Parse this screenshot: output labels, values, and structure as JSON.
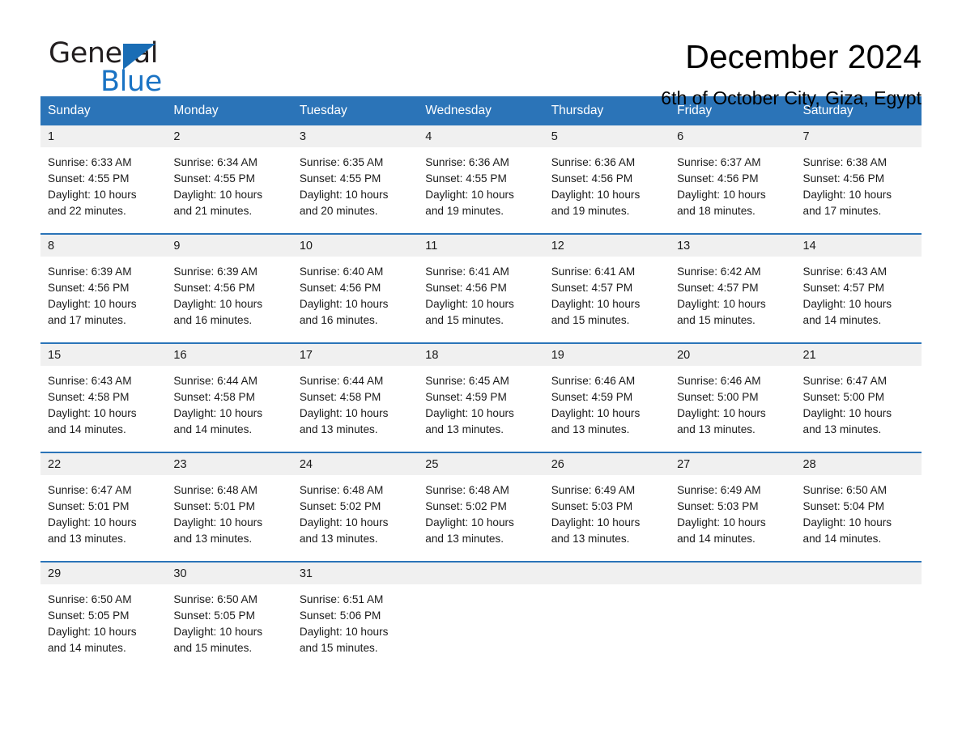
{
  "brand": {
    "name_part1": "General",
    "name_part2": "Blue",
    "triangle_color": "#1a6db5",
    "blue_color": "#1a73c4"
  },
  "header": {
    "month_title": "December 2024",
    "location": "6th of October City, Giza, Egypt"
  },
  "theme": {
    "header_bg": "#2b74b8",
    "daynum_bg": "#f0f0f0",
    "divider": "#2b74b8",
    "text": "#1a1a1a"
  },
  "weekday_headers": [
    "Sunday",
    "Monday",
    "Tuesday",
    "Wednesday",
    "Thursday",
    "Friday",
    "Saturday"
  ],
  "weeks": [
    [
      {
        "day": "1",
        "sunrise": "Sunrise: 6:33 AM",
        "sunset": "Sunset: 4:55 PM",
        "daylight_line1": "Daylight: 10 hours",
        "daylight_line2": "and 22 minutes."
      },
      {
        "day": "2",
        "sunrise": "Sunrise: 6:34 AM",
        "sunset": "Sunset: 4:55 PM",
        "daylight_line1": "Daylight: 10 hours",
        "daylight_line2": "and 21 minutes."
      },
      {
        "day": "3",
        "sunrise": "Sunrise: 6:35 AM",
        "sunset": "Sunset: 4:55 PM",
        "daylight_line1": "Daylight: 10 hours",
        "daylight_line2": "and 20 minutes."
      },
      {
        "day": "4",
        "sunrise": "Sunrise: 6:36 AM",
        "sunset": "Sunset: 4:55 PM",
        "daylight_line1": "Daylight: 10 hours",
        "daylight_line2": "and 19 minutes."
      },
      {
        "day": "5",
        "sunrise": "Sunrise: 6:36 AM",
        "sunset": "Sunset: 4:56 PM",
        "daylight_line1": "Daylight: 10 hours",
        "daylight_line2": "and 19 minutes."
      },
      {
        "day": "6",
        "sunrise": "Sunrise: 6:37 AM",
        "sunset": "Sunset: 4:56 PM",
        "daylight_line1": "Daylight: 10 hours",
        "daylight_line2": "and 18 minutes."
      },
      {
        "day": "7",
        "sunrise": "Sunrise: 6:38 AM",
        "sunset": "Sunset: 4:56 PM",
        "daylight_line1": "Daylight: 10 hours",
        "daylight_line2": "and 17 minutes."
      }
    ],
    [
      {
        "day": "8",
        "sunrise": "Sunrise: 6:39 AM",
        "sunset": "Sunset: 4:56 PM",
        "daylight_line1": "Daylight: 10 hours",
        "daylight_line2": "and 17 minutes."
      },
      {
        "day": "9",
        "sunrise": "Sunrise: 6:39 AM",
        "sunset": "Sunset: 4:56 PM",
        "daylight_line1": "Daylight: 10 hours",
        "daylight_line2": "and 16 minutes."
      },
      {
        "day": "10",
        "sunrise": "Sunrise: 6:40 AM",
        "sunset": "Sunset: 4:56 PM",
        "daylight_line1": "Daylight: 10 hours",
        "daylight_line2": "and 16 minutes."
      },
      {
        "day": "11",
        "sunrise": "Sunrise: 6:41 AM",
        "sunset": "Sunset: 4:56 PM",
        "daylight_line1": "Daylight: 10 hours",
        "daylight_line2": "and 15 minutes."
      },
      {
        "day": "12",
        "sunrise": "Sunrise: 6:41 AM",
        "sunset": "Sunset: 4:57 PM",
        "daylight_line1": "Daylight: 10 hours",
        "daylight_line2": "and 15 minutes."
      },
      {
        "day": "13",
        "sunrise": "Sunrise: 6:42 AM",
        "sunset": "Sunset: 4:57 PM",
        "daylight_line1": "Daylight: 10 hours",
        "daylight_line2": "and 15 minutes."
      },
      {
        "day": "14",
        "sunrise": "Sunrise: 6:43 AM",
        "sunset": "Sunset: 4:57 PM",
        "daylight_line1": "Daylight: 10 hours",
        "daylight_line2": "and 14 minutes."
      }
    ],
    [
      {
        "day": "15",
        "sunrise": "Sunrise: 6:43 AM",
        "sunset": "Sunset: 4:58 PM",
        "daylight_line1": "Daylight: 10 hours",
        "daylight_line2": "and 14 minutes."
      },
      {
        "day": "16",
        "sunrise": "Sunrise: 6:44 AM",
        "sunset": "Sunset: 4:58 PM",
        "daylight_line1": "Daylight: 10 hours",
        "daylight_line2": "and 14 minutes."
      },
      {
        "day": "17",
        "sunrise": "Sunrise: 6:44 AM",
        "sunset": "Sunset: 4:58 PM",
        "daylight_line1": "Daylight: 10 hours",
        "daylight_line2": "and 13 minutes."
      },
      {
        "day": "18",
        "sunrise": "Sunrise: 6:45 AM",
        "sunset": "Sunset: 4:59 PM",
        "daylight_line1": "Daylight: 10 hours",
        "daylight_line2": "and 13 minutes."
      },
      {
        "day": "19",
        "sunrise": "Sunrise: 6:46 AM",
        "sunset": "Sunset: 4:59 PM",
        "daylight_line1": "Daylight: 10 hours",
        "daylight_line2": "and 13 minutes."
      },
      {
        "day": "20",
        "sunrise": "Sunrise: 6:46 AM",
        "sunset": "Sunset: 5:00 PM",
        "daylight_line1": "Daylight: 10 hours",
        "daylight_line2": "and 13 minutes."
      },
      {
        "day": "21",
        "sunrise": "Sunrise: 6:47 AM",
        "sunset": "Sunset: 5:00 PM",
        "daylight_line1": "Daylight: 10 hours",
        "daylight_line2": "and 13 minutes."
      }
    ],
    [
      {
        "day": "22",
        "sunrise": "Sunrise: 6:47 AM",
        "sunset": "Sunset: 5:01 PM",
        "daylight_line1": "Daylight: 10 hours",
        "daylight_line2": "and 13 minutes."
      },
      {
        "day": "23",
        "sunrise": "Sunrise: 6:48 AM",
        "sunset": "Sunset: 5:01 PM",
        "daylight_line1": "Daylight: 10 hours",
        "daylight_line2": "and 13 minutes."
      },
      {
        "day": "24",
        "sunrise": "Sunrise: 6:48 AM",
        "sunset": "Sunset: 5:02 PM",
        "daylight_line1": "Daylight: 10 hours",
        "daylight_line2": "and 13 minutes."
      },
      {
        "day": "25",
        "sunrise": "Sunrise: 6:48 AM",
        "sunset": "Sunset: 5:02 PM",
        "daylight_line1": "Daylight: 10 hours",
        "daylight_line2": "and 13 minutes."
      },
      {
        "day": "26",
        "sunrise": "Sunrise: 6:49 AM",
        "sunset": "Sunset: 5:03 PM",
        "daylight_line1": "Daylight: 10 hours",
        "daylight_line2": "and 13 minutes."
      },
      {
        "day": "27",
        "sunrise": "Sunrise: 6:49 AM",
        "sunset": "Sunset: 5:03 PM",
        "daylight_line1": "Daylight: 10 hours",
        "daylight_line2": "and 14 minutes."
      },
      {
        "day": "28",
        "sunrise": "Sunrise: 6:50 AM",
        "sunset": "Sunset: 5:04 PM",
        "daylight_line1": "Daylight: 10 hours",
        "daylight_line2": "and 14 minutes."
      }
    ],
    [
      {
        "day": "29",
        "sunrise": "Sunrise: 6:50 AM",
        "sunset": "Sunset: 5:05 PM",
        "daylight_line1": "Daylight: 10 hours",
        "daylight_line2": "and 14 minutes."
      },
      {
        "day": "30",
        "sunrise": "Sunrise: 6:50 AM",
        "sunset": "Sunset: 5:05 PM",
        "daylight_line1": "Daylight: 10 hours",
        "daylight_line2": "and 15 minutes."
      },
      {
        "day": "31",
        "sunrise": "Sunrise: 6:51 AM",
        "sunset": "Sunset: 5:06 PM",
        "daylight_line1": "Daylight: 10 hours",
        "daylight_line2": "and 15 minutes."
      },
      {
        "day": "",
        "sunrise": "",
        "sunset": "",
        "daylight_line1": "",
        "daylight_line2": ""
      },
      {
        "day": "",
        "sunrise": "",
        "sunset": "",
        "daylight_line1": "",
        "daylight_line2": ""
      },
      {
        "day": "",
        "sunrise": "",
        "sunset": "",
        "daylight_line1": "",
        "daylight_line2": ""
      },
      {
        "day": "",
        "sunrise": "",
        "sunset": "",
        "daylight_line1": "",
        "daylight_line2": ""
      }
    ]
  ]
}
